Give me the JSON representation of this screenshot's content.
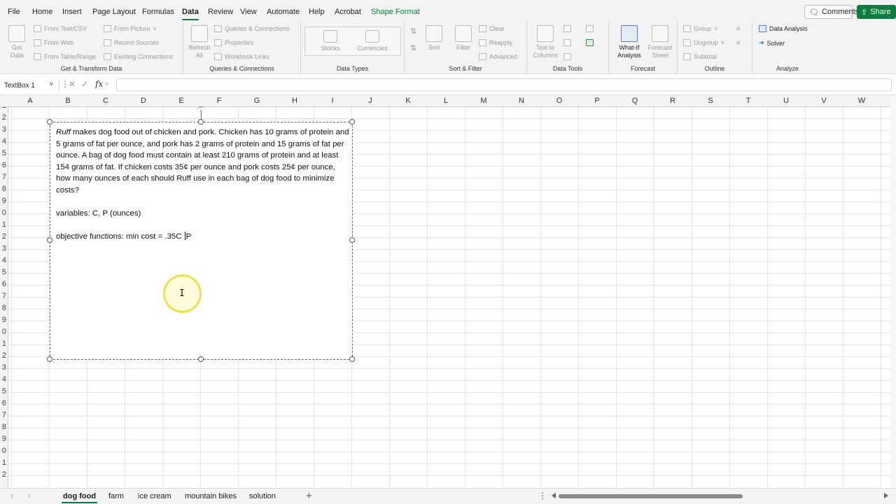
{
  "menu": {
    "tabs": [
      "File",
      "Home",
      "Insert",
      "Page Layout",
      "Formulas",
      "Data",
      "Review",
      "View",
      "Automate",
      "Help",
      "Acrobat",
      "Shape Format"
    ],
    "active_tab": "Data",
    "comments": "Comments",
    "share": "Share"
  },
  "ribbon": {
    "get_transform": {
      "get_data": "Get Data",
      "from_text_csv": "From Text/CSV",
      "from_web": "From Web",
      "from_table_range": "From Table/Range",
      "from_picture": "From Picture",
      "recent_sources": "Recent Sources",
      "existing_connections": "Existing Connections",
      "label": "Get & Transform Data"
    },
    "queries": {
      "refresh_all": "Refresh All",
      "queries_connections": "Queries & Connections",
      "properties": "Properties",
      "workbook_links": "Workbook Links",
      "label": "Queries & Connections"
    },
    "data_types": {
      "stocks": "Stocks",
      "currencies": "Currencies",
      "label": "Data Types"
    },
    "sort_filter": {
      "sort": "Sort",
      "filter": "Filter",
      "clear": "Clear",
      "reapply": "Reapply",
      "advanced": "Advanced",
      "label": "Sort & Filter"
    },
    "data_tools": {
      "text_to_columns": "Text to Columns",
      "label": "Data Tools"
    },
    "forecast": {
      "what_if": "What-If Analysis",
      "forecast_sheet": "Forecast Sheet",
      "label": "Forecast"
    },
    "outline": {
      "group": "Group",
      "ungroup": "Ungroup",
      "subtotal": "Subtotal",
      "label": "Outline"
    },
    "analyze": {
      "data_analysis": "Data Analysis",
      "solver": "Solver",
      "label": "Analyze"
    }
  },
  "formula_bar": {
    "name_box": "TextBox 1",
    "fx": "fx",
    "value": ""
  },
  "grid": {
    "columns": [
      "A",
      "B",
      "C",
      "D",
      "E",
      "F",
      "G",
      "H",
      "I",
      "J",
      "K",
      "L",
      "M",
      "N",
      "O",
      "P",
      "Q",
      "R",
      "S",
      "T",
      "U",
      "V",
      "W"
    ],
    "rows": [
      "1",
      "2",
      "3",
      "4",
      "5",
      "6",
      "7",
      "8",
      "9",
      "0",
      "1",
      "2",
      "3",
      "4",
      "5",
      "6",
      "7",
      "8",
      "9",
      "0",
      "1",
      "2",
      "3",
      "4",
      "5",
      "6",
      "7",
      "8",
      "9",
      "0",
      "1",
      "2"
    ]
  },
  "textbox": {
    "problem_name": "Ruff",
    "problem_rest": " makes dog food out of chicken and pork. Chicken has 10 grams of protein and 5 grams of fat per ounce, and pork has 2 grams of protein and 15 grams of fat per ounce. A bag of dog food must contain at least 210 grams of protein and at least 154 grams of fat. If chicken costs 35¢ per ounce and pork costs 25¢ per ounce, how many ounces of each should Ruff use in each bag of dog food to minimize costs?",
    "variables": "variables:  C, P (ounces)",
    "objective_before_cursor": "objective functions: min cost = .35C ",
    "objective_after_cursor": "P"
  },
  "sheets": {
    "tabs": [
      "dog food",
      "farm",
      "ice cream",
      "mountain bikes",
      "solution"
    ],
    "active": "dog food",
    "add": "+"
  }
}
